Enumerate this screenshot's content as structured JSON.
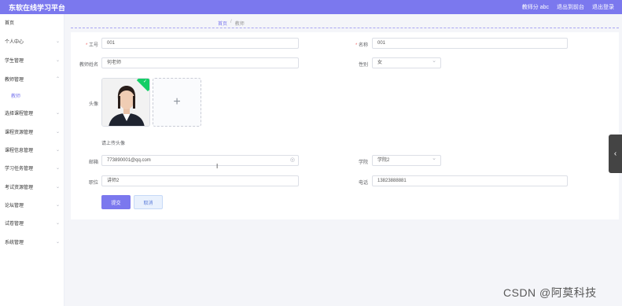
{
  "header": {
    "app_title": "东软在线学习平台",
    "links": [
      "教师分 abc",
      "退出到前台",
      "退出登录"
    ]
  },
  "sidebar": {
    "items": [
      {
        "label": "首页"
      },
      {
        "label": "个人中心"
      },
      {
        "label": "学生管理"
      },
      {
        "label": "教师管理"
      },
      {
        "label": "选择课程管理"
      },
      {
        "label": "课程资源管理"
      },
      {
        "label": "课程信息管理"
      },
      {
        "label": "学习任务管理"
      },
      {
        "label": "考试资源管理"
      },
      {
        "label": "论坛管理"
      },
      {
        "label": "试卷管理"
      },
      {
        "label": "系统管理"
      }
    ],
    "sub_item": "教师"
  },
  "breadcrumb": {
    "home": "首页",
    "separator": "/",
    "current": "教师"
  },
  "form": {
    "gonghao": {
      "label": "工号",
      "value": "001"
    },
    "mingcheng": {
      "label": "名称",
      "value": "001"
    },
    "xingming": {
      "label": "教师姓名",
      "value": "何老师"
    },
    "xingbie": {
      "label": "性别",
      "value": "女"
    },
    "touxiang": {
      "label": "头像",
      "hint": "请上传头像",
      "upload_plus": "+",
      "badge": "✓"
    },
    "youxiang": {
      "label": "邮箱",
      "value": "773890001@qq.com"
    },
    "xueyuan": {
      "label": "学院",
      "value": "学院2"
    },
    "zhiwei": {
      "label": "职位",
      "value": "讲师2"
    },
    "dianhua": {
      "label": "电话",
      "value": "13823888881"
    }
  },
  "buttons": {
    "submit": "提交",
    "cancel": "取消"
  },
  "watermark": "CSDN @阿莫科技",
  "colors": {
    "accent": "#7b78ee",
    "success": "#13ce66",
    "danger": "#f56c6c"
  }
}
